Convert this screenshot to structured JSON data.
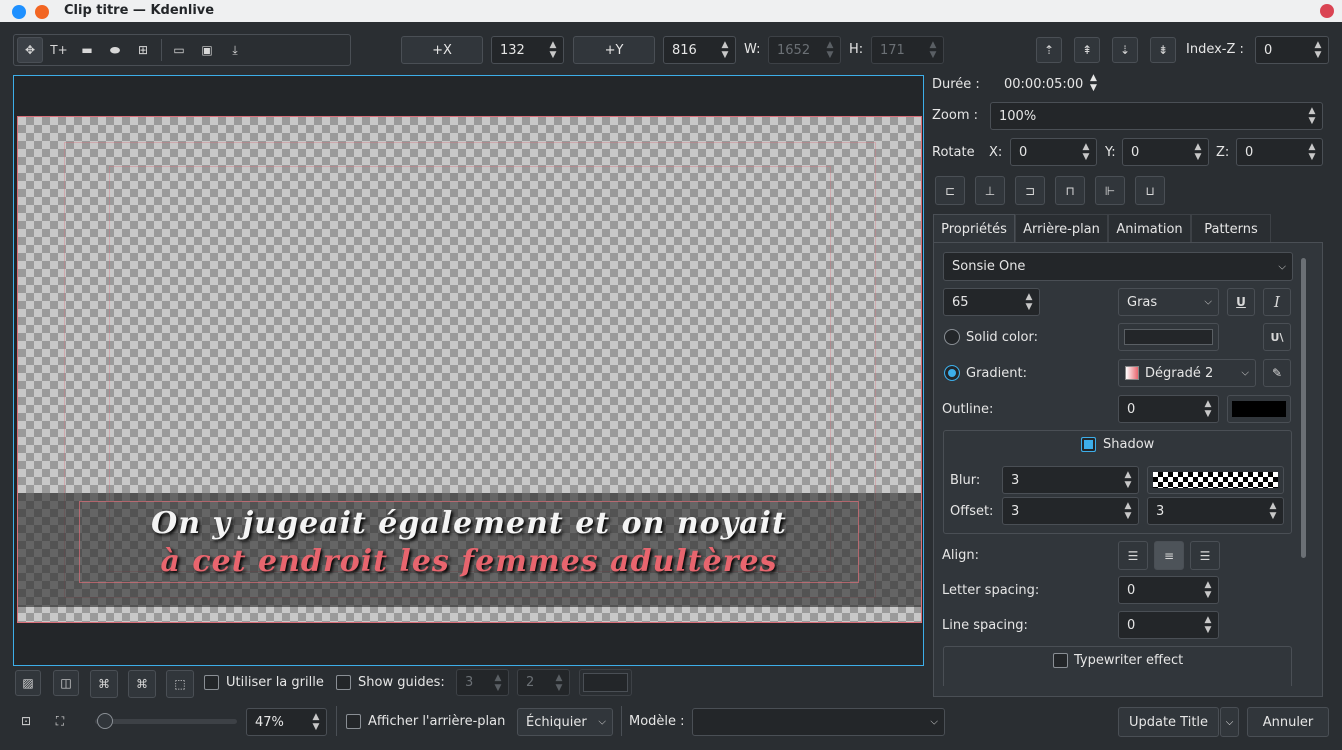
{
  "window": {
    "title": "Clip titre — Kdenlive",
    "colors": {
      "dot1": "#1e90ff",
      "dot2": "#f26522",
      "accent": "#3daee9"
    }
  },
  "toolbar": {
    "tools": [
      "select-icon",
      "text-tool-icon",
      "rectangle-tool-icon",
      "ellipse-tool-icon",
      "image-tool-icon"
    ],
    "file": [
      "open-icon",
      "save-icon",
      "download-icon"
    ],
    "x_button": "+X",
    "x_value": "132",
    "y_button": "+Y",
    "y_value": "816",
    "w_label": "W:",
    "w_value": "1652",
    "h_label": "H:",
    "h_value": "171",
    "z_label": "Index-Z :",
    "z_value": "0"
  },
  "canvas": {
    "line1": "On y jugeait également et on noyait",
    "line2": "à cet endroit les femmes adultères",
    "line1_color": "#f4f4f4",
    "line2_color": "#e8656e"
  },
  "right": {
    "duree_label": "Durée :",
    "duree_value": "00:00:05:00",
    "zoom_label": "Zoom :",
    "zoom_value": "100%",
    "rotate_label": "Rotate",
    "rx_label": "X:",
    "rx": "0",
    "ry_label": "Y:",
    "ry": "0",
    "rz_label": "Z:",
    "rz": "0",
    "tabs": [
      "Propriétés",
      "Arrière-plan",
      "Animation",
      "Patterns"
    ],
    "font": "Sonsie One",
    "size": "65",
    "weight": "Gras",
    "underline": "U",
    "italic": "I",
    "solid_label": "Solid color:",
    "gradient_label": "Gradient:",
    "gradient_value": "Dégradé 2",
    "outline_label": "Outline:",
    "outline_value": "0",
    "shadow_label": "Shadow",
    "blur_label": "Blur:",
    "blur_value": "3",
    "offset_label": "Offset:",
    "offset_x": "3",
    "offset_y": "3",
    "align_label": "Align:",
    "letter_label": "Letter spacing:",
    "letter_value": "0",
    "line_label": "Line spacing:",
    "line_value": "0",
    "typewriter_label": "Typewriter effect"
  },
  "bottom1": {
    "grid_label": "Utiliser la grille",
    "guides_label": "Show guides:",
    "guides_a": "3",
    "guides_b": "2"
  },
  "bottom2": {
    "zoom_value": "47%",
    "zoom_fraction": 0.0,
    "bg_label": "Afficher l'arrière-plan",
    "bg_type": "Échiquier",
    "model_label": "Modèle :",
    "model_value": "",
    "update": "Update Title",
    "cancel": "Annuler"
  }
}
